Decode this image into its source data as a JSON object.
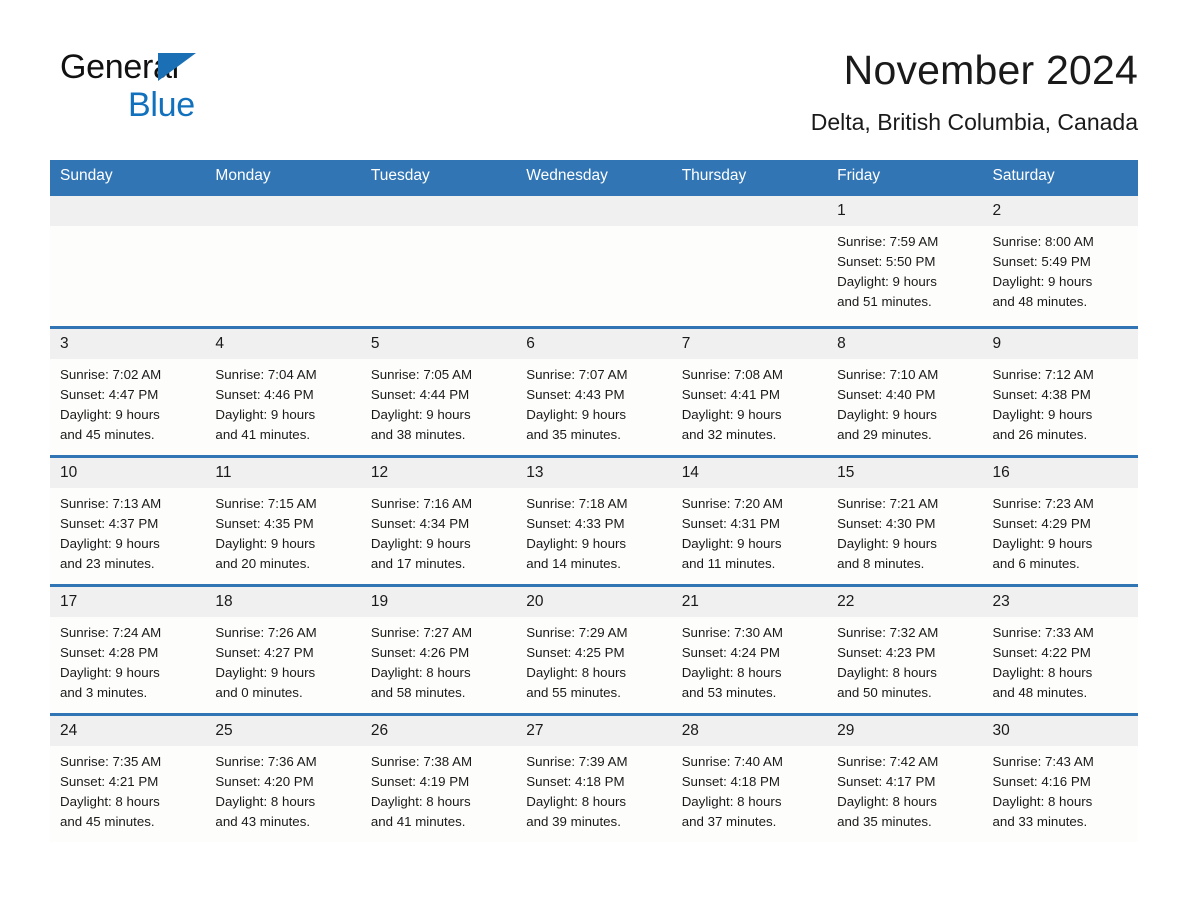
{
  "brand": {
    "line1": "General",
    "line2": "Blue",
    "triangle_color": "#1a6fb5",
    "blue_text_color": "#1271bd"
  },
  "header": {
    "month_title": "November 2024",
    "location": "Delta, British Columbia, Canada",
    "header_bg": "#3275b4",
    "daynum_bg": "#f0f0f0"
  },
  "weekday_headers": [
    "Sunday",
    "Monday",
    "Tuesday",
    "Wednesday",
    "Thursday",
    "Friday",
    "Saturday"
  ],
  "labels": {
    "sunrise_prefix": "Sunrise:",
    "sunset_prefix": "Sunset:",
    "daylight_prefix": "Daylight:"
  },
  "weeks": [
    [
      {
        "day": "",
        "empty": true,
        "l1": "",
        "l2": "",
        "l3": "",
        "l4": ""
      },
      {
        "day": "",
        "empty": true,
        "l1": "",
        "l2": "",
        "l3": "",
        "l4": ""
      },
      {
        "day": "",
        "empty": true,
        "l1": "",
        "l2": "",
        "l3": "",
        "l4": ""
      },
      {
        "day": "",
        "empty": true,
        "l1": "",
        "l2": "",
        "l3": "",
        "l4": ""
      },
      {
        "day": "",
        "empty": true,
        "l1": "",
        "l2": "",
        "l3": "",
        "l4": ""
      },
      {
        "day": "1",
        "empty": false,
        "l1": "Sunrise: 7:59 AM",
        "l2": "Sunset: 5:50 PM",
        "l3": "Daylight: 9 hours",
        "l4": "and 51 minutes."
      },
      {
        "day": "2",
        "empty": false,
        "l1": "Sunrise: 8:00 AM",
        "l2": "Sunset: 5:49 PM",
        "l3": "Daylight: 9 hours",
        "l4": "and 48 minutes."
      }
    ],
    [
      {
        "day": "3",
        "empty": false,
        "l1": "Sunrise: 7:02 AM",
        "l2": "Sunset: 4:47 PM",
        "l3": "Daylight: 9 hours",
        "l4": "and 45 minutes."
      },
      {
        "day": "4",
        "empty": false,
        "l1": "Sunrise: 7:04 AM",
        "l2": "Sunset: 4:46 PM",
        "l3": "Daylight: 9 hours",
        "l4": "and 41 minutes."
      },
      {
        "day": "5",
        "empty": false,
        "l1": "Sunrise: 7:05 AM",
        "l2": "Sunset: 4:44 PM",
        "l3": "Daylight: 9 hours",
        "l4": "and 38 minutes."
      },
      {
        "day": "6",
        "empty": false,
        "l1": "Sunrise: 7:07 AM",
        "l2": "Sunset: 4:43 PM",
        "l3": "Daylight: 9 hours",
        "l4": "and 35 minutes."
      },
      {
        "day": "7",
        "empty": false,
        "l1": "Sunrise: 7:08 AM",
        "l2": "Sunset: 4:41 PM",
        "l3": "Daylight: 9 hours",
        "l4": "and 32 minutes."
      },
      {
        "day": "8",
        "empty": false,
        "l1": "Sunrise: 7:10 AM",
        "l2": "Sunset: 4:40 PM",
        "l3": "Daylight: 9 hours",
        "l4": "and 29 minutes."
      },
      {
        "day": "9",
        "empty": false,
        "l1": "Sunrise: 7:12 AM",
        "l2": "Sunset: 4:38 PM",
        "l3": "Daylight: 9 hours",
        "l4": "and 26 minutes."
      }
    ],
    [
      {
        "day": "10",
        "empty": false,
        "l1": "Sunrise: 7:13 AM",
        "l2": "Sunset: 4:37 PM",
        "l3": "Daylight: 9 hours",
        "l4": "and 23 minutes."
      },
      {
        "day": "11",
        "empty": false,
        "l1": "Sunrise: 7:15 AM",
        "l2": "Sunset: 4:35 PM",
        "l3": "Daylight: 9 hours",
        "l4": "and 20 minutes."
      },
      {
        "day": "12",
        "empty": false,
        "l1": "Sunrise: 7:16 AM",
        "l2": "Sunset: 4:34 PM",
        "l3": "Daylight: 9 hours",
        "l4": "and 17 minutes."
      },
      {
        "day": "13",
        "empty": false,
        "l1": "Sunrise: 7:18 AM",
        "l2": "Sunset: 4:33 PM",
        "l3": "Daylight: 9 hours",
        "l4": "and 14 minutes."
      },
      {
        "day": "14",
        "empty": false,
        "l1": "Sunrise: 7:20 AM",
        "l2": "Sunset: 4:31 PM",
        "l3": "Daylight: 9 hours",
        "l4": "and 11 minutes."
      },
      {
        "day": "15",
        "empty": false,
        "l1": "Sunrise: 7:21 AM",
        "l2": "Sunset: 4:30 PM",
        "l3": "Daylight: 9 hours",
        "l4": "and 8 minutes."
      },
      {
        "day": "16",
        "empty": false,
        "l1": "Sunrise: 7:23 AM",
        "l2": "Sunset: 4:29 PM",
        "l3": "Daylight: 9 hours",
        "l4": "and 6 minutes."
      }
    ],
    [
      {
        "day": "17",
        "empty": false,
        "l1": "Sunrise: 7:24 AM",
        "l2": "Sunset: 4:28 PM",
        "l3": "Daylight: 9 hours",
        "l4": "and 3 minutes."
      },
      {
        "day": "18",
        "empty": false,
        "l1": "Sunrise: 7:26 AM",
        "l2": "Sunset: 4:27 PM",
        "l3": "Daylight: 9 hours",
        "l4": "and 0 minutes."
      },
      {
        "day": "19",
        "empty": false,
        "l1": "Sunrise: 7:27 AM",
        "l2": "Sunset: 4:26 PM",
        "l3": "Daylight: 8 hours",
        "l4": "and 58 minutes."
      },
      {
        "day": "20",
        "empty": false,
        "l1": "Sunrise: 7:29 AM",
        "l2": "Sunset: 4:25 PM",
        "l3": "Daylight: 8 hours",
        "l4": "and 55 minutes."
      },
      {
        "day": "21",
        "empty": false,
        "l1": "Sunrise: 7:30 AM",
        "l2": "Sunset: 4:24 PM",
        "l3": "Daylight: 8 hours",
        "l4": "and 53 minutes."
      },
      {
        "day": "22",
        "empty": false,
        "l1": "Sunrise: 7:32 AM",
        "l2": "Sunset: 4:23 PM",
        "l3": "Daylight: 8 hours",
        "l4": "and 50 minutes."
      },
      {
        "day": "23",
        "empty": false,
        "l1": "Sunrise: 7:33 AM",
        "l2": "Sunset: 4:22 PM",
        "l3": "Daylight: 8 hours",
        "l4": "and 48 minutes."
      }
    ],
    [
      {
        "day": "24",
        "empty": false,
        "l1": "Sunrise: 7:35 AM",
        "l2": "Sunset: 4:21 PM",
        "l3": "Daylight: 8 hours",
        "l4": "and 45 minutes."
      },
      {
        "day": "25",
        "empty": false,
        "l1": "Sunrise: 7:36 AM",
        "l2": "Sunset: 4:20 PM",
        "l3": "Daylight: 8 hours",
        "l4": "and 43 minutes."
      },
      {
        "day": "26",
        "empty": false,
        "l1": "Sunrise: 7:38 AM",
        "l2": "Sunset: 4:19 PM",
        "l3": "Daylight: 8 hours",
        "l4": "and 41 minutes."
      },
      {
        "day": "27",
        "empty": false,
        "l1": "Sunrise: 7:39 AM",
        "l2": "Sunset: 4:18 PM",
        "l3": "Daylight: 8 hours",
        "l4": "and 39 minutes."
      },
      {
        "day": "28",
        "empty": false,
        "l1": "Sunrise: 7:40 AM",
        "l2": "Sunset: 4:18 PM",
        "l3": "Daylight: 8 hours",
        "l4": "and 37 minutes."
      },
      {
        "day": "29",
        "empty": false,
        "l1": "Sunrise: 7:42 AM",
        "l2": "Sunset: 4:17 PM",
        "l3": "Daylight: 8 hours",
        "l4": "and 35 minutes."
      },
      {
        "day": "30",
        "empty": false,
        "l1": "Sunrise: 7:43 AM",
        "l2": "Sunset: 4:16 PM",
        "l3": "Daylight: 8 hours",
        "l4": "and 33 minutes."
      }
    ]
  ]
}
